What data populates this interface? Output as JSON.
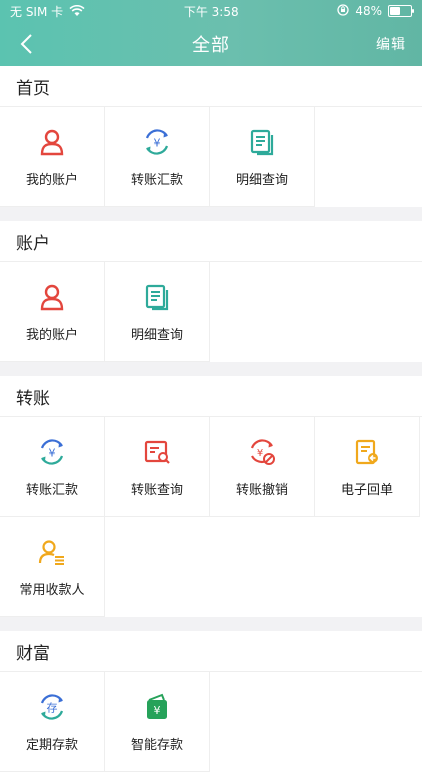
{
  "status": {
    "carrier": "无 SIM 卡",
    "time": "下午 3:58",
    "battery": "48%"
  },
  "nav": {
    "title": "全部",
    "edit_label": "编辑"
  },
  "sections": [
    {
      "title": "首页",
      "items": [
        {
          "label": "我的账户",
          "icon": "user-icon",
          "color": "#e3463d"
        },
        {
          "label": "转账汇款",
          "icon": "transfer-yuan-icon",
          "color": "#3b6fd6"
        },
        {
          "label": "明细查询",
          "icon": "document-icon",
          "color": "#2eaa9a"
        }
      ]
    },
    {
      "title": "账户",
      "items": [
        {
          "label": "我的账户",
          "icon": "user-icon",
          "color": "#e3463d"
        },
        {
          "label": "明细查询",
          "icon": "document-icon",
          "color": "#2eaa9a"
        }
      ]
    },
    {
      "title": "转账",
      "items": [
        {
          "label": "转账汇款",
          "icon": "transfer-yuan-icon",
          "color": "#3b6fd6"
        },
        {
          "label": "转账查询",
          "icon": "search-list-icon",
          "color": "#e3463d"
        },
        {
          "label": "转账撤销",
          "icon": "cancel-yuan-icon",
          "color": "#e3463d"
        },
        {
          "label": "电子回单",
          "icon": "receipt-icon",
          "color": "#f0a81c"
        },
        {
          "label": "常用收款人",
          "icon": "payee-icon",
          "color": "#f0a81c"
        }
      ]
    },
    {
      "title": "财富",
      "items": [
        {
          "label": "定期存款",
          "icon": "deposit-icon",
          "color": "#3b6fd6"
        },
        {
          "label": "智能存款",
          "icon": "wallet-icon",
          "color": "#26a25a"
        }
      ]
    }
  ]
}
